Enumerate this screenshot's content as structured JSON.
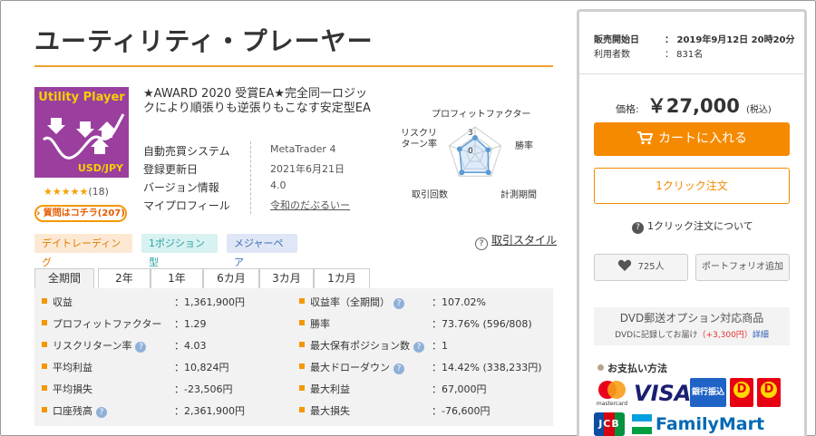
{
  "product": {
    "title": "ユーティリティ・プレーヤー",
    "image_title": "Utility Player",
    "image_pair": "USD/JPY",
    "stars": "★★★★★",
    "rating_count": "(18)",
    "question_badge": "質問はコチラ(207)",
    "description": "★AWARD 2020 受賞EA★完全同一ロジックにより順張りも逆張りもこなす安定型EA"
  },
  "info": [
    {
      "label": "自動売買システム",
      "value": "MetaTrader 4"
    },
    {
      "label": "登録更新日",
      "value": "2021年6月21日"
    },
    {
      "label": "バージョン情報",
      "value": "4.0"
    },
    {
      "label": "マイプロフィール",
      "value": "令和のだぶるいー"
    }
  ],
  "radar": {
    "labels": [
      "プロフィットファクター",
      "勝率",
      "計測期間",
      "取引回数",
      "リスクリターン率"
    ],
    "scale_labels": [
      "3",
      "0"
    ],
    "max": 3,
    "values": [
      1.8,
      1.5,
      2.5,
      2.5,
      1.8
    ]
  },
  "tags": [
    "デイトレーディング",
    "1ポジション型",
    "メジャーペア"
  ],
  "trade_style": {
    "icon": "?",
    "label": "取引スタイル"
  },
  "tabs": [
    "全期間",
    "2年",
    "1年",
    "6カ月",
    "3カ月",
    "1カ月"
  ],
  "stats": {
    "left": [
      {
        "label": "収益",
        "value": "：1,361,900円",
        "help": false
      },
      {
        "label": "プロフィットファクター",
        "value": "：1.29",
        "help": false
      },
      {
        "label": "リスクリターン率",
        "value": "：4.03",
        "help": true
      },
      {
        "label": "平均利益",
        "value": "：10,824円",
        "help": false
      },
      {
        "label": "平均損失",
        "value": "：-23,506円",
        "help": false
      },
      {
        "label": "口座残高",
        "value": "：2,361,900円",
        "help": true
      }
    ],
    "right": [
      {
        "label": "収益率（全期間）",
        "value": "：107.02%",
        "help": true
      },
      {
        "label": "勝率",
        "value": "：73.76% (596/808)",
        "help": false
      },
      {
        "label": "最大保有ポジション数",
        "value": "：1",
        "help": true
      },
      {
        "label": "最大ドローダウン",
        "value": "：14.42% (338,233円)",
        "help": true
      },
      {
        "label": "最大利益",
        "value": "：67,000円",
        "help": false
      },
      {
        "label": "最大損失",
        "value": "：-76,600円",
        "help": false
      }
    ]
  },
  "panel": {
    "release_label": "販売開始日",
    "release_value": "：  2019年9月12日 20時20分",
    "users_label": "利用者数",
    "users_value": "：  831名",
    "price_label": "価格:",
    "price_value": "￥27,000",
    "price_tax": "(税込)",
    "cart_label": "カートに入れる",
    "oneclick_label": "1クリック注文",
    "oneclick_help": "1クリック注文について",
    "fav_count": "725人",
    "portfolio_label": "ポートフォリオ追加",
    "dvd_title": "DVD郵送オプション対応商品",
    "dvd_note_a": "DVDに記録してお届け",
    "dvd_note_price": "（+3,300円）",
    "dvd_note_link": "詳細",
    "payment_heading": "お支払い方法",
    "payment": {
      "mastercard": "mastercard",
      "visa": "VISA",
      "bank": "銀行振込",
      "jcb": "JCB",
      "familymart": "FamilyMart"
    }
  },
  "colors": {
    "accent": "#f58a00",
    "tag_orange": "#e07b00",
    "purple": "#9b3f9f"
  }
}
